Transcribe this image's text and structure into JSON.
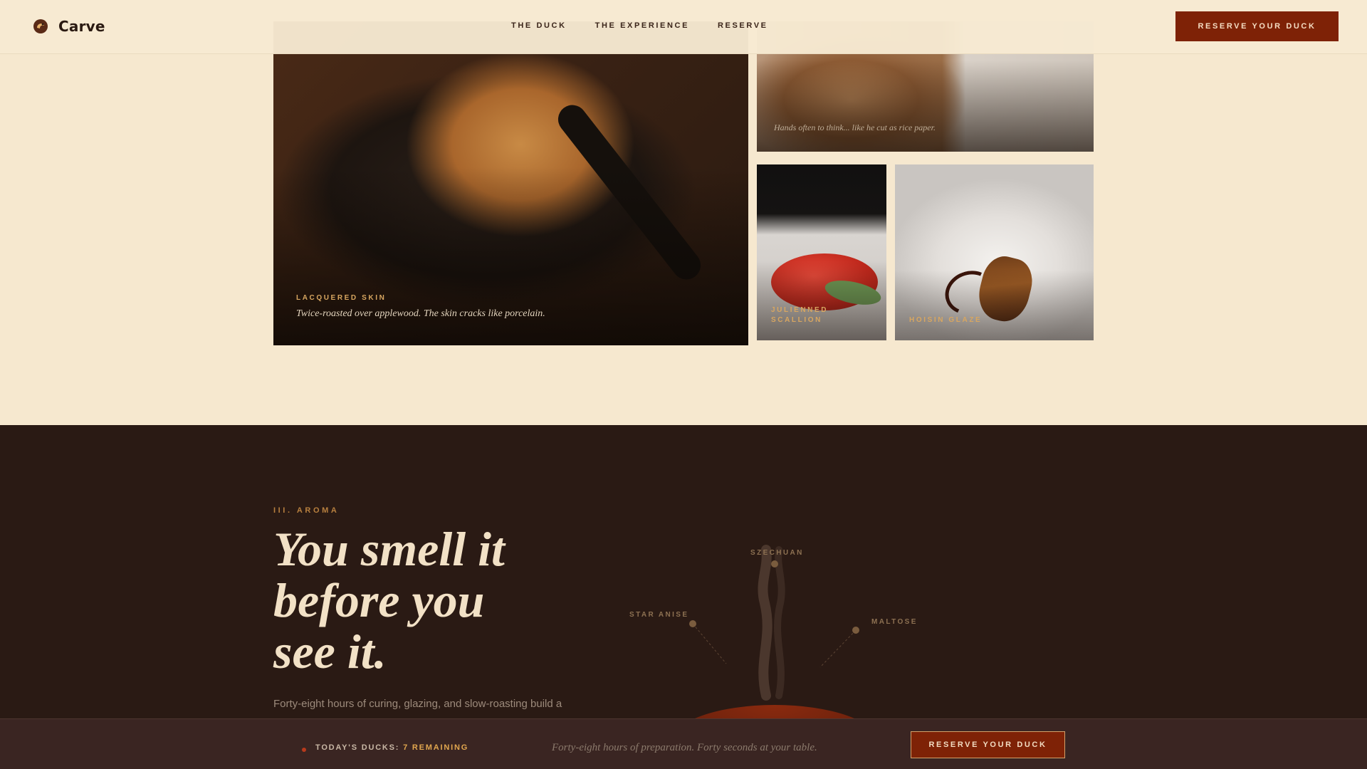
{
  "brand": {
    "name": "Carve",
    "logo_icon": "duck-logo-icon"
  },
  "nav": {
    "items": [
      {
        "label": "THE DUCK"
      },
      {
        "label": "THE EXPERIENCE"
      },
      {
        "label": "RESERVE"
      }
    ],
    "cta_label": "RESERVE YOUR DUCK"
  },
  "gallery": {
    "featured": {
      "label": "LACQUERED SKIN",
      "text": "Twice-roasted over applewood. The skin cracks like porcelain."
    },
    "top_right": {
      "text": "Hands often to think... like he cut as rice paper."
    },
    "small_a": {
      "label_line1": "JULIENNED",
      "label_line2": "SCALLION"
    },
    "small_b": {
      "label": "HOISIN GLAZE"
    }
  },
  "aroma": {
    "eyebrow": "III. AROMA",
    "headline_line1": "You smell it",
    "headline_line2": "before you",
    "headline_line3": "see it.",
    "body": "Forty-eight hours of curing, glazing, and slow-roasting build a",
    "notes": [
      {
        "label": "SZECHUAN"
      },
      {
        "label": "STAR ANISE"
      },
      {
        "label": "MALTOSE"
      }
    ]
  },
  "bottom_bar": {
    "status_prefix": "TODAY'S DUCKS:",
    "status_count": "7 REMAINING",
    "tagline": "Forty-eight hours of preparation. Forty seconds at your table.",
    "cta_label": "RESERVE YOUR DUCK"
  },
  "colors": {
    "background": "#f6e8cf",
    "accent": "#7e2206",
    "gold": "#d8a660",
    "dark": "#2a1a14"
  }
}
